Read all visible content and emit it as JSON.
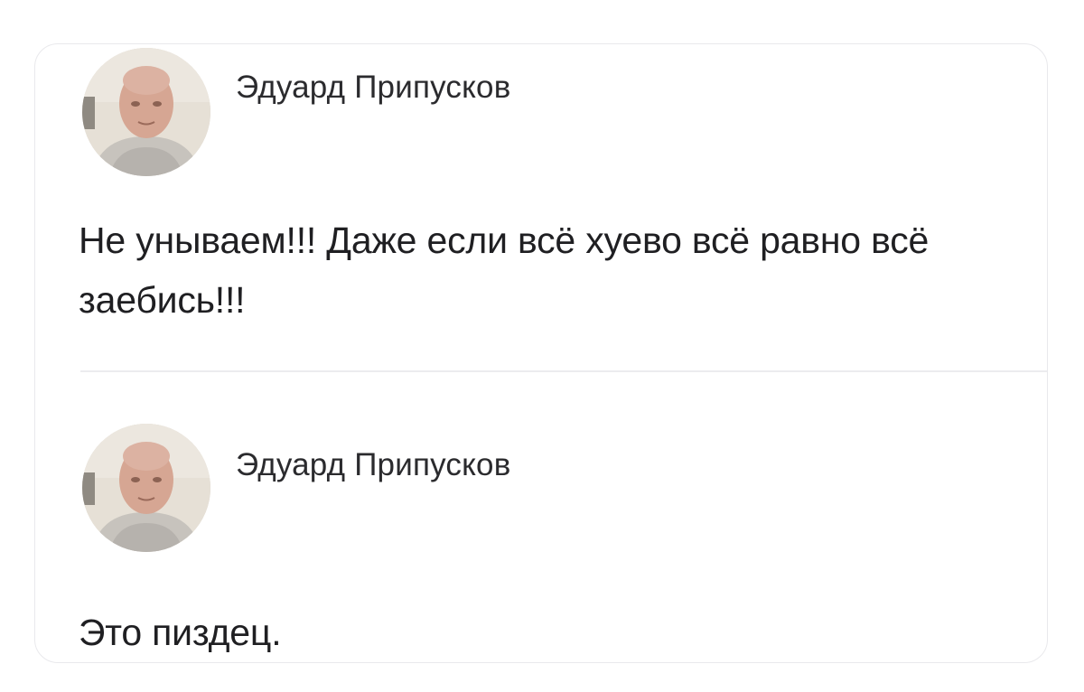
{
  "posts": [
    {
      "author": "Эдуард Припусков",
      "text": "Не унываем!!! Даже если всё хуево всё равно всё заебись!!!"
    },
    {
      "author": "Эдуард Припусков",
      "text": "Это пиздец."
    }
  ],
  "colors": {
    "background": "#ffffff",
    "card_border": "#e9e9ec",
    "author_text": "#2b2b2e",
    "body_text": "#1f1f22",
    "divider": "#ececef"
  }
}
